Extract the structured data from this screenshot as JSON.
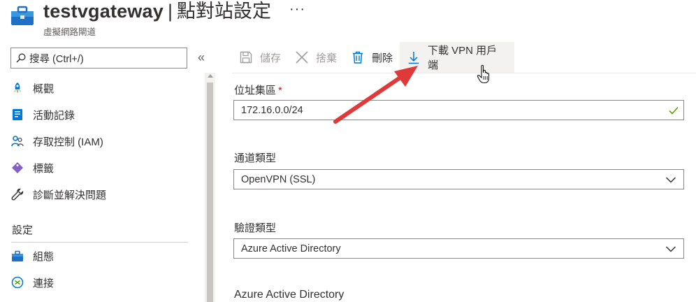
{
  "header": {
    "title": "testvgateway",
    "separator": "|",
    "page_name": "點對站設定",
    "more": "···",
    "subtitle": "虛擬網路閘道"
  },
  "sidebar": {
    "search_placeholder": "搜尋 (Ctrl+/)",
    "collapse": "«",
    "items": [
      {
        "label": "概觀",
        "icon": "overview-rocket-icon"
      },
      {
        "label": "活動記錄",
        "icon": "activity-log-icon"
      },
      {
        "label": "存取控制 (IAM)",
        "icon": "iam-people-icon"
      },
      {
        "label": "標籤",
        "icon": "tag-icon"
      },
      {
        "label": "診斷並解決問題",
        "icon": "wrench-icon"
      }
    ],
    "section_title": "設定",
    "settings_items": [
      {
        "label": "組態",
        "icon": "configuration-icon"
      },
      {
        "label": "連接",
        "icon": "connections-icon"
      }
    ]
  },
  "toolbar": {
    "save_label": "儲存",
    "discard_label": "捨棄",
    "delete_label": "刪除",
    "download_label": "下載 VPN 用戶端"
  },
  "form": {
    "address_pool_label": "位址集區",
    "address_pool_required": "*",
    "address_pool_value": "172.16.0.0/24",
    "tunnel_type_label": "通道類型",
    "tunnel_type_value": "OpenVPN (SSL)",
    "auth_type_label": "驗證類型",
    "auth_type_value": "Azure Active Directory",
    "aad_section_label": "Azure Active Directory"
  },
  "colors": {
    "accent_blue": "#0078d4",
    "valid_green": "#57a300",
    "annotation_red": "#e0393a",
    "required_red": "#a4262c"
  }
}
